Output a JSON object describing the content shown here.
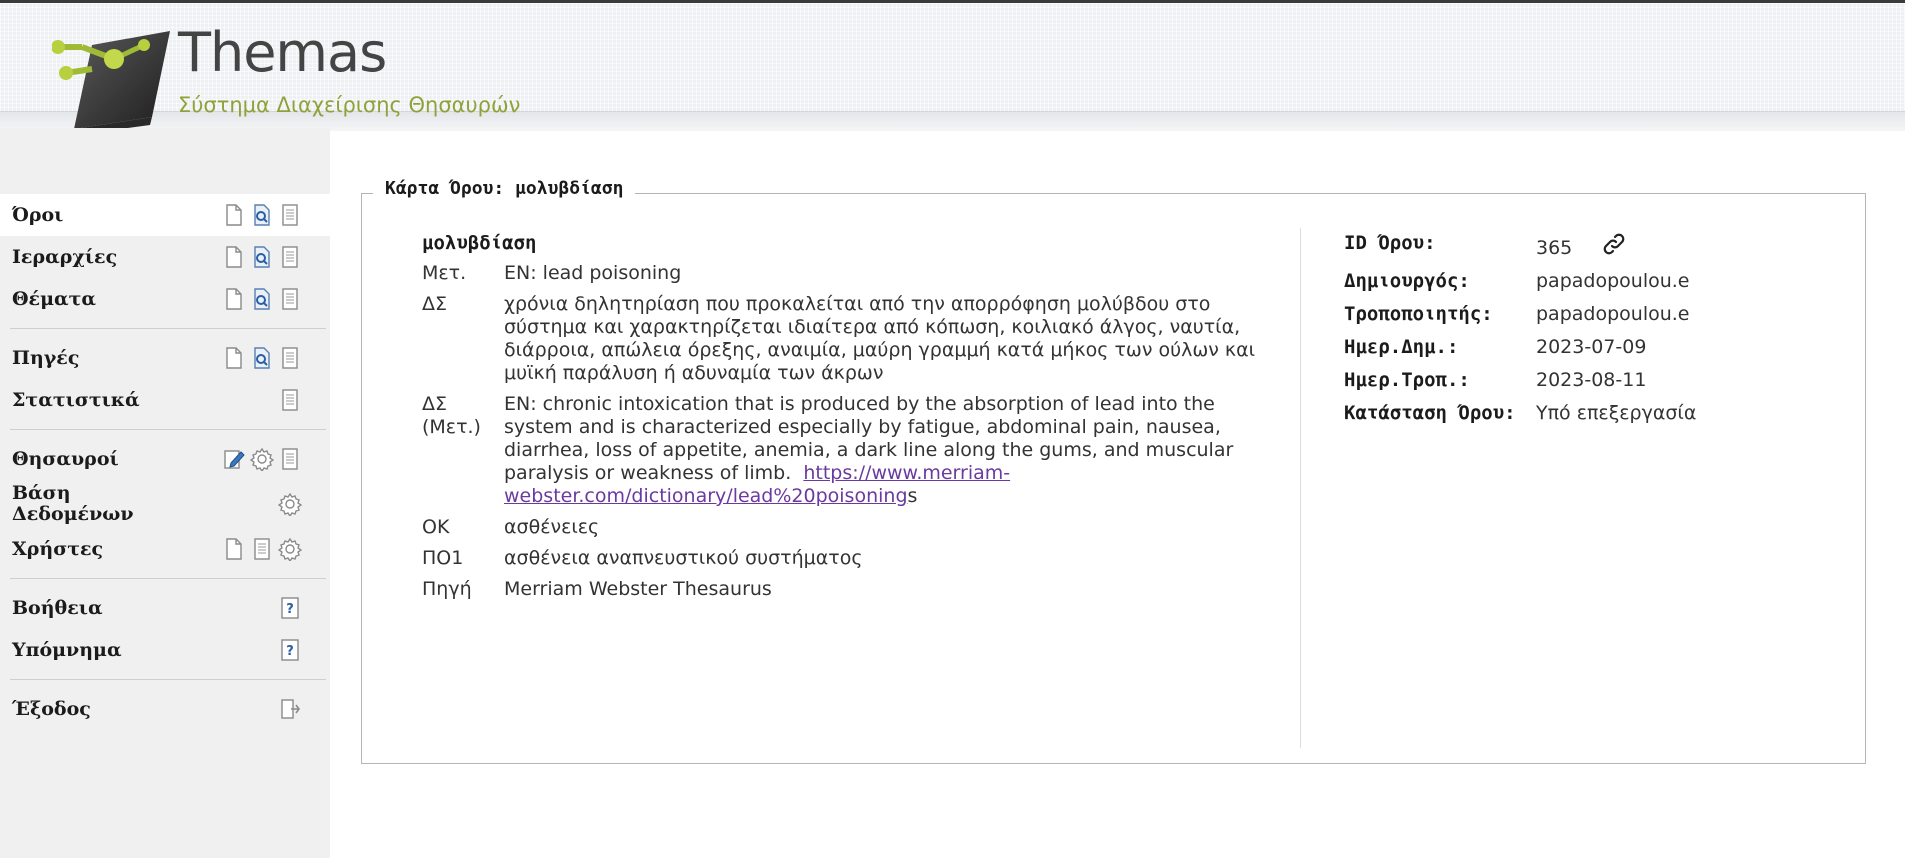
{
  "header": {
    "app_name": "Themas",
    "subtitle": "Σύστημα Διαχείρισης Θησαυρών"
  },
  "sidebar": {
    "groups": [
      [
        {
          "label": "Όροι",
          "icons": [
            "new-document-icon",
            "search-document-icon",
            "list-document-icon"
          ],
          "active": true
        },
        {
          "label": "Ιεραρχίες",
          "icons": [
            "new-document-icon",
            "search-document-icon",
            "list-document-icon"
          ]
        },
        {
          "label": "Θέματα",
          "icons": [
            "new-document-icon",
            "search-document-icon",
            "list-document-icon"
          ]
        }
      ],
      [
        {
          "label": "Πηγές",
          "icons": [
            "new-document-icon",
            "search-document-icon",
            "list-document-icon"
          ]
        },
        {
          "label": "Στατιστικά",
          "icons": [
            "list-document-icon"
          ]
        }
      ],
      [
        {
          "label": "Θησαυροί",
          "icons": [
            "edit-icon",
            "gear-icon",
            "list-document-icon"
          ]
        },
        {
          "label": "Βάση Δεδομένων",
          "icons": [
            "gear-icon"
          ]
        },
        {
          "label": "Χρήστες",
          "icons": [
            "new-document-icon",
            "list-document-icon",
            "gear-icon"
          ]
        }
      ],
      [
        {
          "label": "Βοήθεια",
          "icons": [
            "help-icon"
          ]
        },
        {
          "label": "Υπόμνημα",
          "icons": [
            "help-icon"
          ]
        }
      ],
      [
        {
          "label": "Έξοδος",
          "icons": [
            "exit-icon"
          ]
        }
      ]
    ]
  },
  "card": {
    "legend": "Κάρτα Όρου: μολυβδίαση",
    "term": "μολυβδίαση",
    "rows": [
      {
        "label": "Μετ.",
        "value": "EN: lead poisoning"
      },
      {
        "label": "ΔΣ",
        "value": "χρόνια δηλητηρίαση που προκαλείται από την απορρόφηση μολύβδου στο σύστημα και χαρακτηρίζεται ιδιαίτερα από κόπωση, κοιλιακό άλγος, ναυτία, διάρροια, απώλεια όρεξης, αναιμία, μαύρη γραμμή κατά μήκος των ούλων και μυϊκή παράλυση ή αδυναμία των άκρων"
      },
      {
        "label": "ΔΣ (Μετ.)",
        "value": "EN: chronic intoxication that is produced by the absorption of lead into the system and is characterized especially by fatigue, abdominal pain, nausea, diarrhea, loss of appetite, anemia, a dark line along the gums, and muscular paralysis or weakness of limb.",
        "link": "https://www.merriam-webster.com/dictionary/lead%20poisoning",
        "suffix": "s"
      },
      {
        "label": "ΟΚ",
        "value": "ασθένειες"
      },
      {
        "label": "ΠΟ1",
        "value": "ασθένεια αναπνευστικού συστήματος"
      },
      {
        "label": "Πηγή",
        "value": "Merriam Webster Thesaurus"
      }
    ],
    "meta": [
      {
        "key": "ID Όρου:",
        "value": "365",
        "link_icon": true
      },
      {
        "key": "Δημιουργός:",
        "value": "papadopoulou.e"
      },
      {
        "key": "Τροποποιητής:",
        "value": "papadopoulou.e"
      },
      {
        "key": "Ημερ.Δημ.:",
        "value": "2023-07-09"
      },
      {
        "key": "Ημερ.Τροπ.:",
        "value": "2023-08-11"
      },
      {
        "key": "Κατάσταση Όρου:",
        "value": "Υπό επεξεργασία"
      }
    ]
  }
}
